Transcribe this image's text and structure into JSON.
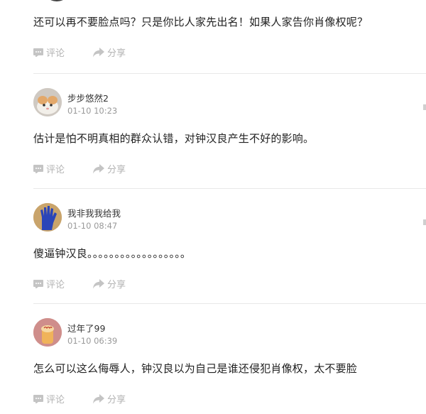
{
  "comments": [
    {
      "text": "还可以再不要脸点吗？只是你比人家先出名！如果人家告你肖像权呢？",
      "comment_label": "评论",
      "share_label": "分享"
    },
    {
      "username": "步步悠然2",
      "time": "01-10 10:23",
      "text": "估计是怕不明真相的群众认错，对钟汉良产生不好的影响。",
      "comment_label": "评论",
      "share_label": "分享"
    },
    {
      "username": "我非我我给我",
      "time": "01-10 08:47",
      "text": "傻逼钟汉良。。。。。。。。。。。。。。。。。。",
      "comment_label": "评论",
      "share_label": "分享"
    },
    {
      "username": "过年了99",
      "time": "01-10 06:39",
      "text": "怎么可以这么侮辱人，钟汉良以为自己是谁还侵犯肖像权，太不要脸",
      "comment_label": "评论",
      "share_label": "分享"
    }
  ],
  "colors": {
    "action_gray": "#b3b3b3",
    "divider": "#e8e8e8",
    "time_gray": "#999999"
  },
  "icons": [
    "comment-icon",
    "share-icon"
  ]
}
